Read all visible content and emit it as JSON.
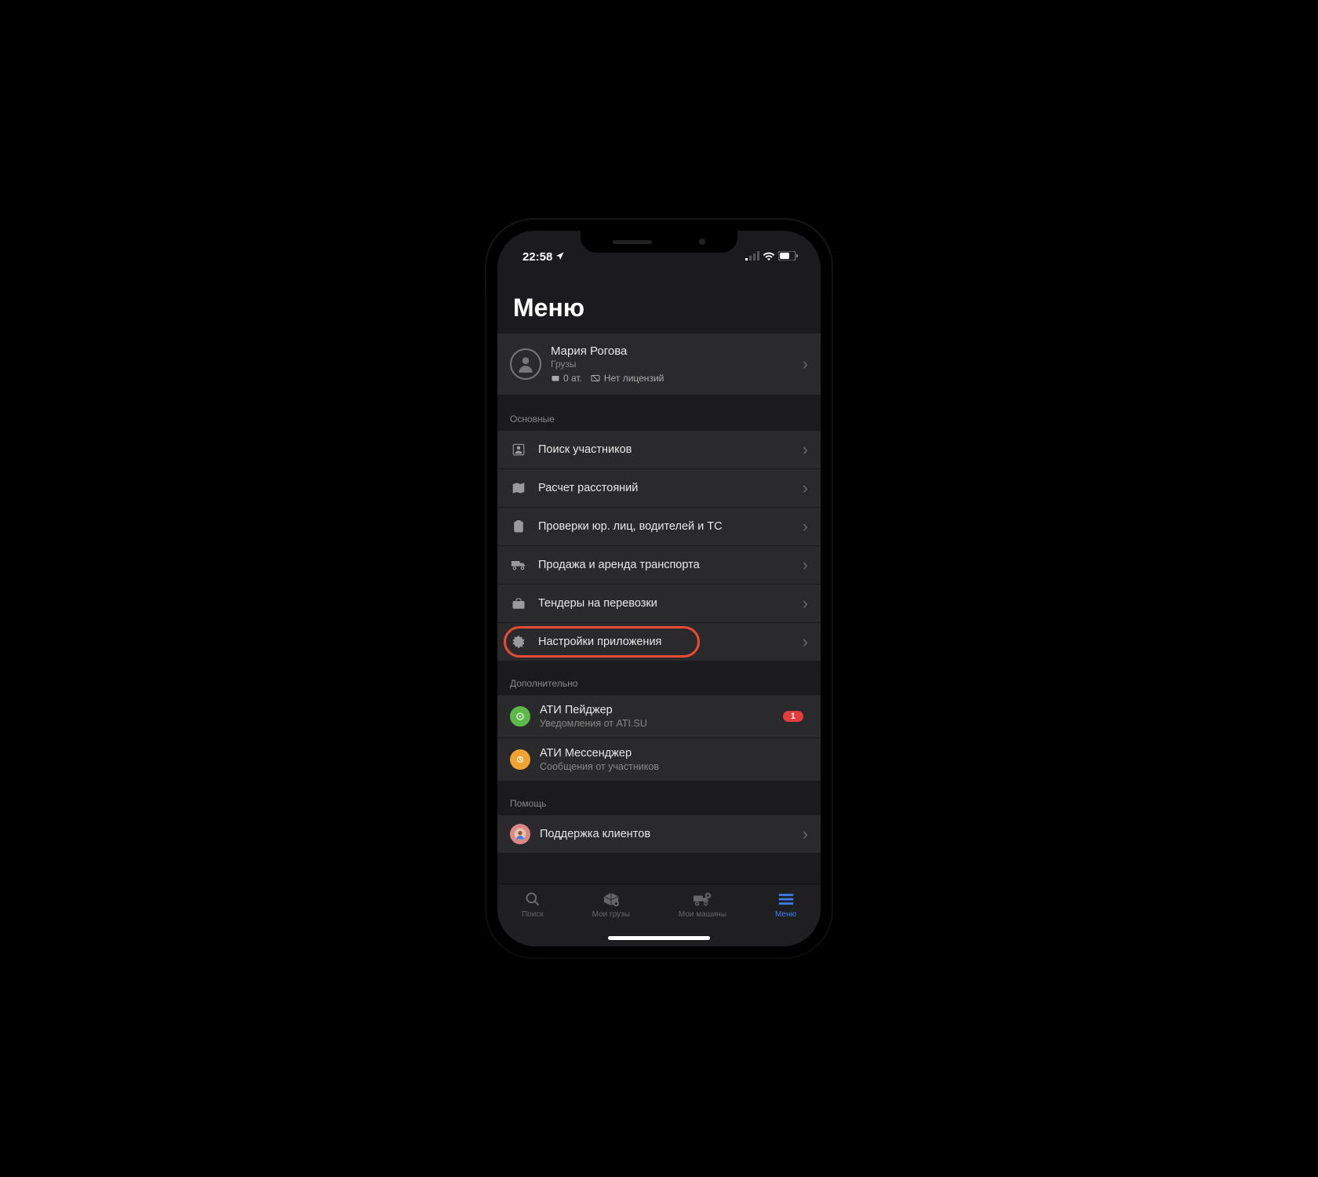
{
  "status": {
    "time": "22:58"
  },
  "header": {
    "title": "Меню"
  },
  "profile": {
    "name": "Мария Рогова",
    "subtitle": "Грузы",
    "balance": "0 ат.",
    "license": "Нет лицензий"
  },
  "sections": {
    "main": {
      "label": "Основные",
      "items": [
        {
          "label": "Поиск участников"
        },
        {
          "label": "Расчет расстояний"
        },
        {
          "label": "Проверки юр. лиц, водителей и ТС"
        },
        {
          "label": "Продажа и аренда транспорта"
        },
        {
          "label": "Тендеры на перевозки"
        },
        {
          "label": "Настройки приложения"
        }
      ]
    },
    "extra": {
      "label": "Дополнительно",
      "items": [
        {
          "title": "АТИ Пейджер",
          "sub": "Уведомления от ATI.SU",
          "badge": "1"
        },
        {
          "title": "АТИ Мессенджер",
          "sub": "Сообщения от участников"
        }
      ]
    },
    "help": {
      "label": "Помощь",
      "items": [
        {
          "label": "Поддержка клиентов"
        }
      ]
    }
  },
  "tabs": [
    {
      "label": "Поиск"
    },
    {
      "label": "Мои грузы"
    },
    {
      "label": "Мои машины"
    },
    {
      "label": "Меню"
    }
  ],
  "colors": {
    "accent": "#3a7ef0",
    "highlight": "#e94b35",
    "badge": "#e23d3d"
  }
}
